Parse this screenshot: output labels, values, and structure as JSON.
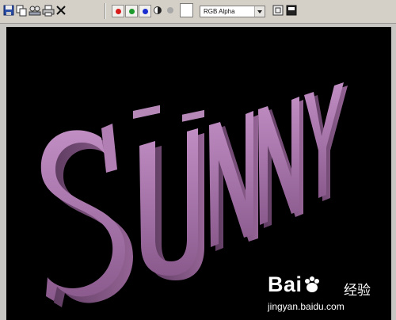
{
  "toolbar": {
    "tools": [
      {
        "icon": "save-image-icon"
      },
      {
        "icon": "copy-image-icon"
      },
      {
        "icon": "clone-window-icon"
      },
      {
        "icon": "print-icon"
      },
      {
        "icon": "clear-icon"
      }
    ],
    "channels": {
      "red": "#d81b1b",
      "green": "#1c9a2c",
      "blue": "#1b2fd0"
    },
    "display_channel_value": "RGB Alpha",
    "swatch_color": "#ffffff"
  },
  "viewport": {
    "render_text": "SUNNY",
    "text_color": "#a774aa",
    "background": "#000000"
  },
  "watermark": {
    "brand": "Bai",
    "brand_suffix": "经验",
    "url": "jingyan.baidu.com"
  }
}
